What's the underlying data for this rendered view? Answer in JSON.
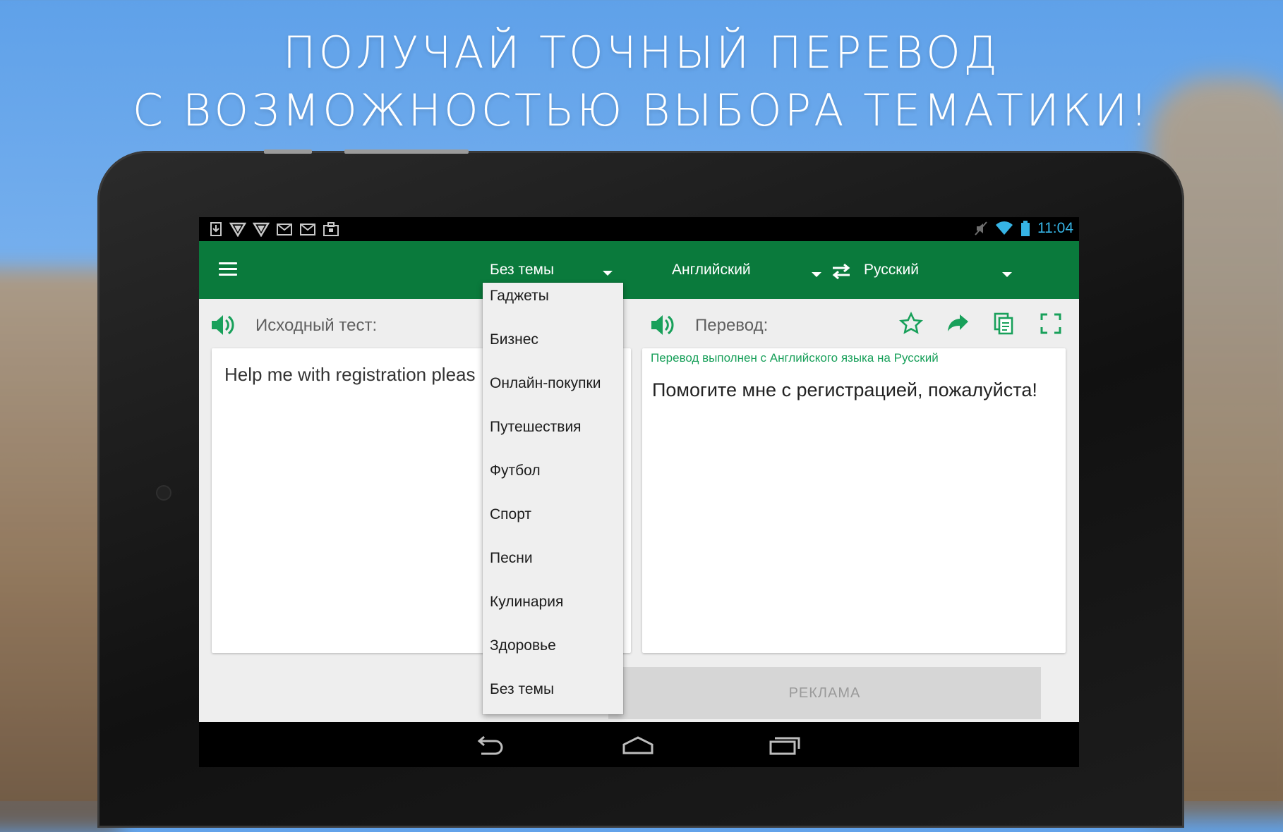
{
  "promo": {
    "line1": "ПОЛУЧАЙ ТОЧНЫЙ ПЕРЕВОД",
    "line2": "С ВОЗМОЖНОСТЬЮ ВЫБОРА ТЕМАТИКИ!"
  },
  "status_bar": {
    "time": "11:04",
    "icons": [
      "download-icon",
      "shield-icon",
      "shield-icon",
      "mail-icon",
      "mail-icon",
      "briefcase-icon",
      "mute-icon",
      "wifi-icon",
      "battery-icon"
    ]
  },
  "toolbar": {
    "menu_icon": "hamburger-icon",
    "topic_selected": "Без темы",
    "source_language": "Английский",
    "target_language": "Русский",
    "swap_icon": "swap-arrows-icon"
  },
  "source": {
    "label": "Исходный тест:",
    "text": "Help me  with registration pleas"
  },
  "translation": {
    "label": "Перевод:",
    "note": "Перевод выполнен с Английского языка на Русский",
    "text": "Помогите мне с регистрацией, пожалуйста!",
    "icons": [
      "star-icon",
      "share-icon",
      "copy-icon",
      "fullscreen-icon"
    ]
  },
  "ad": {
    "label": "РЕКЛАМА"
  },
  "topics": {
    "items": [
      "Гаджеты",
      "Бизнес",
      "Онлайн-покупки",
      "Путешествия",
      "Футбол",
      "Спорт",
      "Песни",
      "Кулинария",
      "Здоровье",
      "Без темы"
    ]
  },
  "colors": {
    "toolbar": "#0a7a3c",
    "accent_green": "#18a05a",
    "status_time": "#36b4e5"
  }
}
